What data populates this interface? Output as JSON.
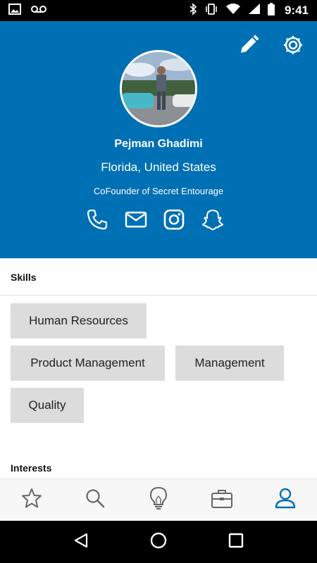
{
  "status_bar": {
    "time": "9:41",
    "icons": [
      "image-icon",
      "voicemail-icon",
      "bluetooth-icon",
      "vibrate-icon",
      "wifi-icon",
      "signal-icon",
      "battery-icon"
    ]
  },
  "header": {
    "background": "#0070b4",
    "edit_icon": "pencil-icon",
    "settings_icon": "gear-icon"
  },
  "profile": {
    "name": "Pejman Ghadimi",
    "location": "Florida, United States",
    "title": "CoFounder of Secret Entourage",
    "contacts": [
      "phone-icon",
      "mail-icon",
      "instagram-icon",
      "snapchat-icon"
    ]
  },
  "skills": {
    "title": "Skills",
    "items": [
      "Human Resources",
      "Product Management",
      "Management",
      "Quality"
    ]
  },
  "interests": {
    "title": "Interests"
  },
  "bottom_nav": {
    "items": [
      "star-icon",
      "search-icon",
      "lightbulb-icon",
      "briefcase-icon",
      "profile-icon"
    ],
    "active_index": 4,
    "active_color": "#0070b4",
    "inactive_color": "#666666"
  },
  "android_nav": [
    "back-icon",
    "home-icon",
    "recents-icon"
  ]
}
